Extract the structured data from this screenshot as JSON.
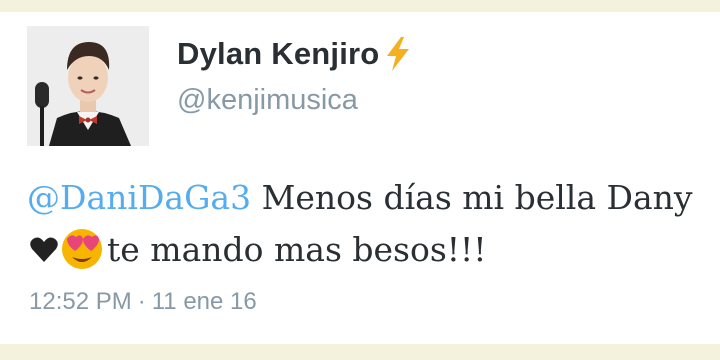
{
  "tweet": {
    "display_name": "Dylan Kenjiro",
    "name_emoji": "lightning-bolt",
    "handle": "@kenjimusica",
    "mention": "@DaniDaGa3",
    "text_part1": " Menos días mi bella Dany",
    "heart_emoji": "black-heart",
    "face_emoji": "heart-eyes-face",
    "text_part2": "te mando mas besos!!!",
    "time": "12:52 PM",
    "separator": "·",
    "date": "11 ene 16"
  },
  "colors": {
    "background": "#f4f1dc",
    "card": "#ffffff",
    "name": "#292f33",
    "handle": "#8899a6",
    "mention": "#55acee",
    "bolt": "#f5b020"
  }
}
